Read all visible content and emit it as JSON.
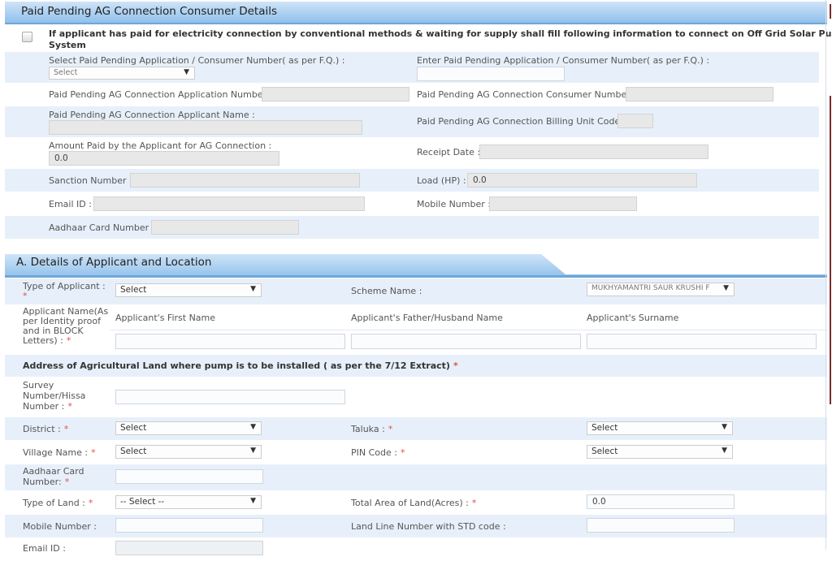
{
  "paid_pending": {
    "title": "Paid Pending AG Connection Consumer Details",
    "checkbox_text_line1": "If applicant has paid for electricity connection by conventional methods & waiting for supply shall fill following information to connect on Off Grid Solar Pumping",
    "checkbox_text_line2": "System",
    "select_app_label": "Select Paid Pending Application / Consumer Number( as per F.Q.) :",
    "select_app_value": "Select",
    "enter_app_label": "Enter Paid Pending Application / Consumer Number( as per F.Q.) :",
    "enter_app_value": "",
    "app_number_label": "Paid Pending AG Connection Application Number :",
    "consumer_number_label": "Paid Pending AG Connection Consumer Number :",
    "applicant_name_label": "Paid Pending AG Connection Applicant Name :",
    "billing_unit_label": "Paid Pending AG Connection Billing Unit Code :",
    "amount_paid_label": "Amount Paid by the Applicant for AG Connection :",
    "amount_paid_value": "0.0",
    "receipt_date_label": "Receipt Date :",
    "sanction_label": "Sanction Number :",
    "load_label": "Load (HP) :",
    "load_value": "0.0",
    "email_label": "Email ID :",
    "mobile_label": "Mobile Number :",
    "aadhaar_label": "Aadhaar Card Number :"
  },
  "section_a": {
    "title": "A. Details of Applicant and Location",
    "type_applicant_label": "Type of Applicant :",
    "type_applicant_value": "Select",
    "scheme_label": "Scheme Name :",
    "scheme_value": "MUKHYAMANTRI SAUR KRUSHI F",
    "applicant_name_label_l1": "Applicant Name(As",
    "applicant_name_label_l2": "per Identity proof",
    "applicant_name_label_l3": "and in BLOCK",
    "applicant_name_label_l4": "Letters) :",
    "first_name_label": "Applicant's First Name",
    "father_name_label": "Applicant's Father/Husband Name",
    "surname_label": "Applicant's Surname",
    "address_heading": "Address of Agricultural Land where pump is to be installed ( as per the 7/12 Extract)",
    "survey_label_l1": "Survey",
    "survey_label_l2": "Number/Hissa",
    "survey_label_l3": "Number :",
    "district_label": "District :",
    "district_value": "Select",
    "taluka_label": "Taluka :",
    "taluka_value": "Select",
    "village_label": "Village Name :",
    "village_value": "Select",
    "pin_label": "PIN Code :",
    "pin_value": "Select",
    "aadhaar_label_l1": "Aadhaar Card",
    "aadhaar_label_l2": "Number:",
    "land_type_label": "Type of Land :",
    "land_type_value": "-- Select --",
    "total_area_label": "Total Area of Land(Acres) :",
    "total_area_value": "0.0",
    "mobile_label": "Mobile Number :",
    "landline_label": "Land Line Number with STD code :",
    "email_label": "Email ID :"
  },
  "required_mark": "*",
  "arrow_glyph": "▼"
}
